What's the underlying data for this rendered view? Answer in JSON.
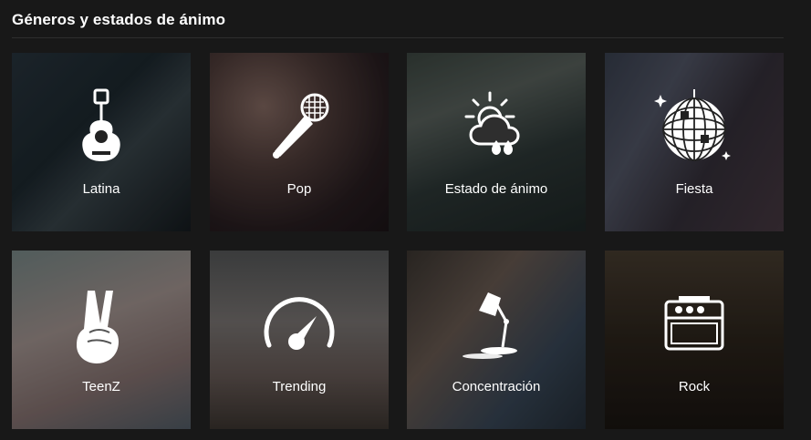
{
  "section": {
    "title": "Géneros y estados de ánimo"
  },
  "tiles": [
    {
      "label": "Latina",
      "icon": "guitar-icon"
    },
    {
      "label": "Pop",
      "icon": "microphone-icon"
    },
    {
      "label": "Estado de ánimo",
      "icon": "weather-icon"
    },
    {
      "label": "Fiesta",
      "icon": "disco-ball-icon"
    },
    {
      "label": "TeenZ",
      "icon": "peace-hand-icon"
    },
    {
      "label": "Trending",
      "icon": "gauge-icon"
    },
    {
      "label": "Concentración",
      "icon": "desk-lamp-icon"
    },
    {
      "label": "Rock",
      "icon": "amplifier-icon"
    }
  ]
}
